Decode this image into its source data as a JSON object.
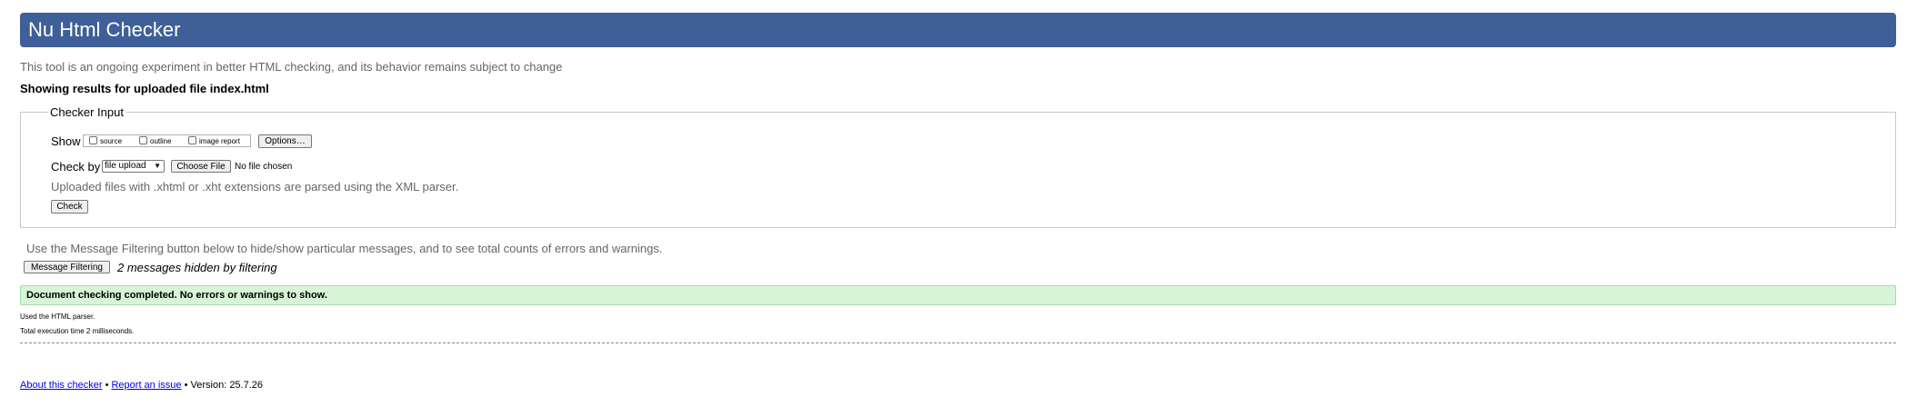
{
  "header": {
    "title": "Nu Html Checker"
  },
  "intro": "This tool is an ongoing experiment in better HTML checking, and its behavior remains subject to change",
  "results_for": "Showing results for uploaded file index.html",
  "checker_input": {
    "legend": "Checker Input",
    "show_label": "Show",
    "show_options": [
      {
        "label": "source",
        "checked": false
      },
      {
        "label": "outline",
        "checked": false
      },
      {
        "label": "image report",
        "checked": false
      }
    ],
    "options_button": "Options…",
    "check_by_label": "Check by",
    "check_by_value": "file upload",
    "choose_file_button": "Choose File",
    "no_file_text": "No file chosen",
    "xml_note": "Uploaded files with .xhtml or .xht extensions are parsed using the XML parser.",
    "check_button": "Check"
  },
  "filter_note": "Use the Message Filtering button below to hide/show particular messages, and to see total counts of errors and warnings.",
  "message_filtering_button": "Message Filtering",
  "hidden_messages": "2 messages hidden by filtering",
  "success_message": "Document checking completed. No errors or warnings to show.",
  "details": {
    "parser": "Used the HTML parser.",
    "execution_time": "Total execution time 2 milliseconds."
  },
  "footer": {
    "about_link": "About this checker",
    "separator": "•",
    "report_link": "Report an issue",
    "version": "Version: 25.7.26"
  },
  "colors": {
    "header_bg": "#3e5f98",
    "success_bg": "#d6f5d6",
    "link": "#0000ee",
    "muted_text": "#666666"
  }
}
